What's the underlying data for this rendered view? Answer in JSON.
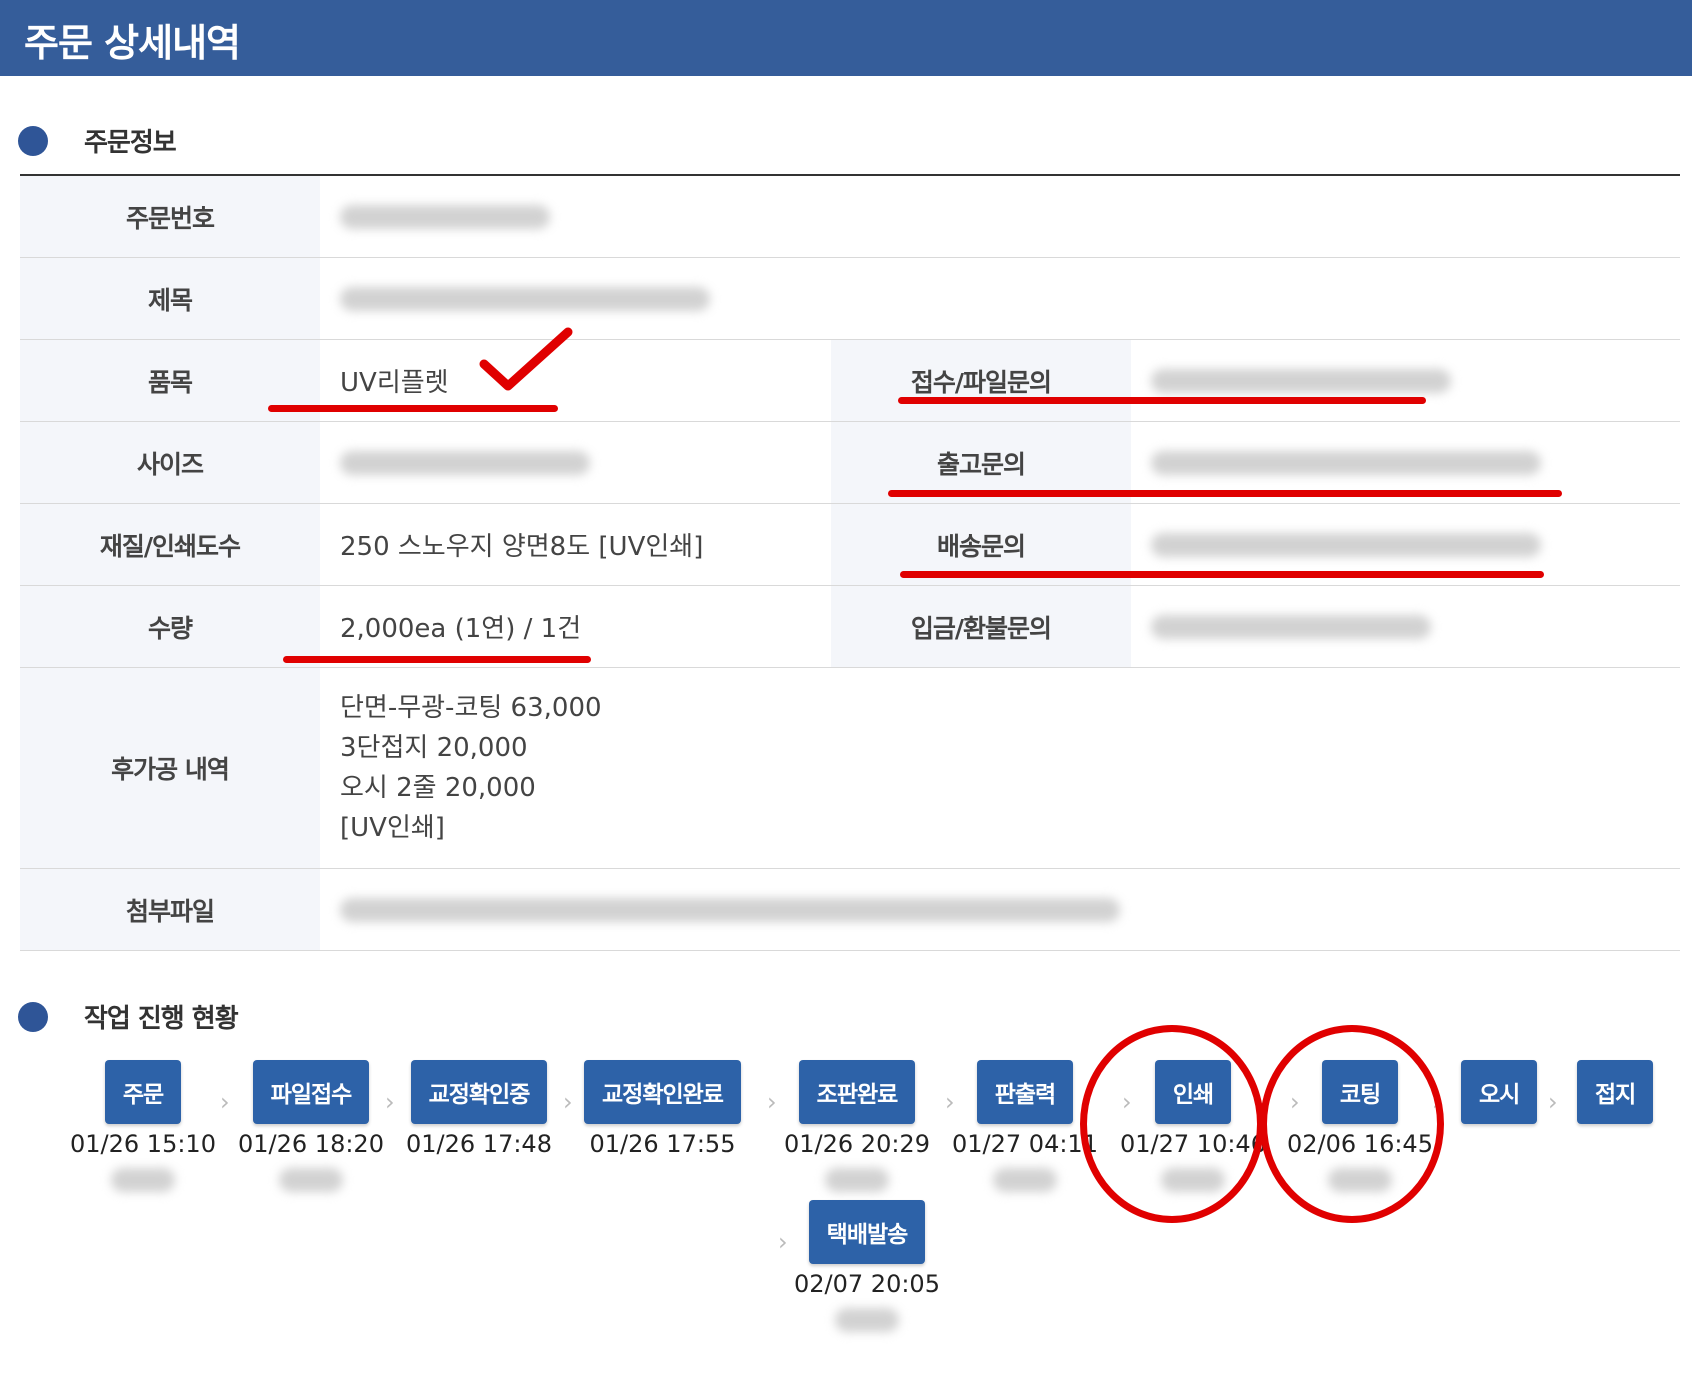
{
  "header": {
    "title": "주문 상세내역"
  },
  "order_info": {
    "section_title": "주문정보",
    "labels": {
      "order_no": "주문번호",
      "title": "제목",
      "item": "품목",
      "size": "사이즈",
      "material": "재질/인쇄도수",
      "quantity": "수량",
      "post": "후가공 내역",
      "attachment": "첨부파일",
      "reception": "접수/파일문의",
      "release": "출고문의",
      "delivery": "배송문의",
      "refund": "입금/환불문의"
    },
    "values": {
      "item": "UV리플렛",
      "material": "250 스노우지 양면8도 [UV인쇄]",
      "quantity": "2,000ea (1연) / 1건",
      "post_lines": [
        "단면-무광-코팅 63,000",
        "3단접지 20,000",
        "오시 2줄 20,000",
        "[UV인쇄]"
      ]
    }
  },
  "progress": {
    "section_title": "작업 진행 현황",
    "steps": [
      {
        "label": "주문",
        "date": "01/26 15:10"
      },
      {
        "label": "파일접수",
        "date": "01/26 18:20"
      },
      {
        "label": "교정확인중",
        "date": "01/26 17:48"
      },
      {
        "label": "교정확인완료",
        "date": "01/26 17:55"
      },
      {
        "label": "조판완료",
        "date": "01/26 20:29"
      },
      {
        "label": "판출력",
        "date": "01/27 04:11"
      },
      {
        "label": "인쇄",
        "date": "01/27 10:46"
      },
      {
        "label": "코팅",
        "date": "02/06 16:45"
      },
      {
        "label": "오시",
        "date": ""
      },
      {
        "label": "접지",
        "date": ""
      },
      {
        "label": "택배발송",
        "date": "02/07 20:05"
      }
    ]
  },
  "colors": {
    "header": "#355d9a",
    "button": "#2d62a8",
    "annotation": "#e00000"
  }
}
